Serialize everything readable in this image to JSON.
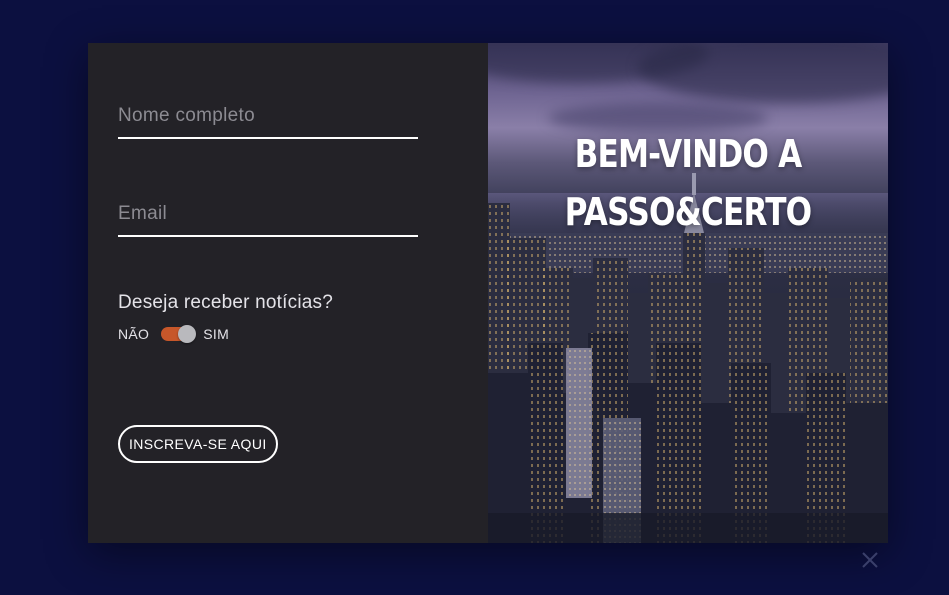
{
  "form": {
    "name_placeholder": "Nome completo",
    "email_placeholder": "Email",
    "newsletter_question": "Deseja receber notícias?",
    "toggle_off_label": "NÃO",
    "toggle_on_label": "SIM",
    "toggle_state": "on",
    "submit_label": "INSCREVA-SE AQUI"
  },
  "hero": {
    "title_line1": "BEM-VINDO A",
    "title_line2": "PASSO&CERTO"
  },
  "colors": {
    "page_background": "#0c1040",
    "form_panel": "#232227",
    "toggle_accent": "#c7572a",
    "text": "#ffffff"
  },
  "icons": {
    "close": "close-icon"
  }
}
